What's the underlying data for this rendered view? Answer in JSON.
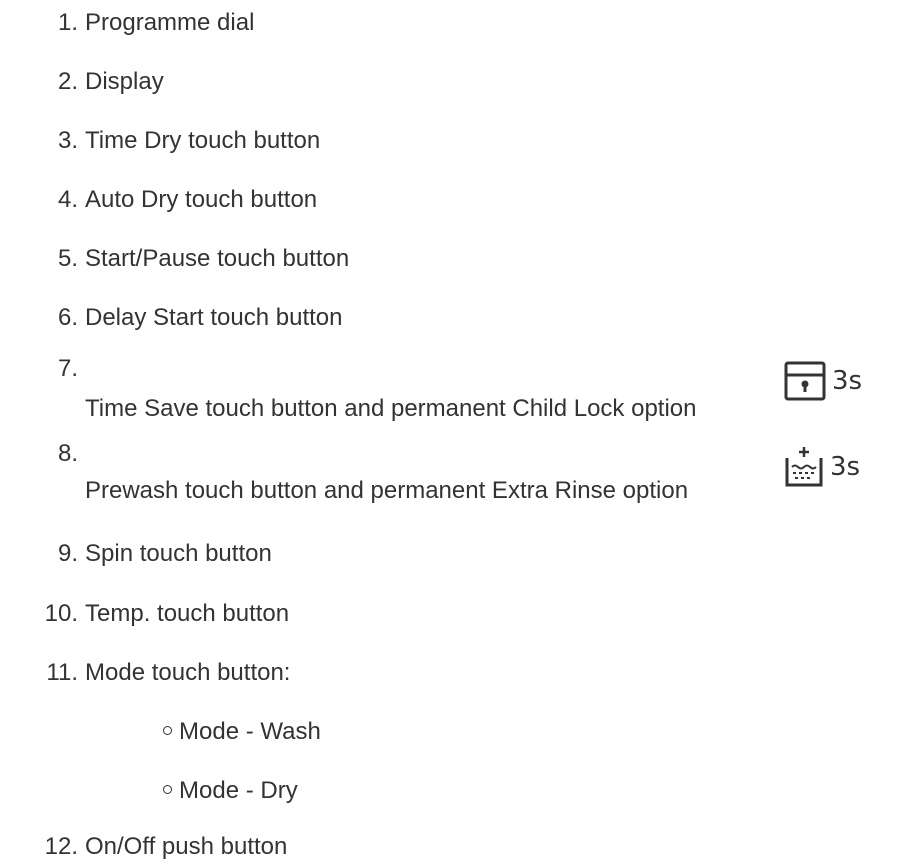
{
  "items": [
    {
      "num": "1.",
      "text": "Programme dial"
    },
    {
      "num": "2.",
      "text": "Display"
    },
    {
      "num": "3.",
      "text": "Time Dry touch button"
    },
    {
      "num": "4.",
      "text": "Auto Dry touch button"
    },
    {
      "num": "5.",
      "text": "Start/Pause touch button"
    },
    {
      "num": "6.",
      "text": "Delay Start touch button"
    },
    {
      "num": "7.",
      "text": "Time Save touch button and permanent Child Lock option",
      "icon": "child-lock-icon",
      "suffix": "3s"
    },
    {
      "num": "8.",
      "text": "Prewash touch button and permanent Extra Rinse option",
      "icon": "extra-rinse-icon",
      "suffix": "3s"
    },
    {
      "num": "9.",
      "text": "Spin touch button"
    },
    {
      "num": "10.",
      "text": "Temp. touch button"
    },
    {
      "num": "11.",
      "text": "Mode touch button:"
    },
    {
      "num": "12.",
      "text": "On/Off push button"
    }
  ],
  "subitems": [
    {
      "text": "Mode - Wash"
    },
    {
      "text": "Mode - Dry"
    }
  ]
}
